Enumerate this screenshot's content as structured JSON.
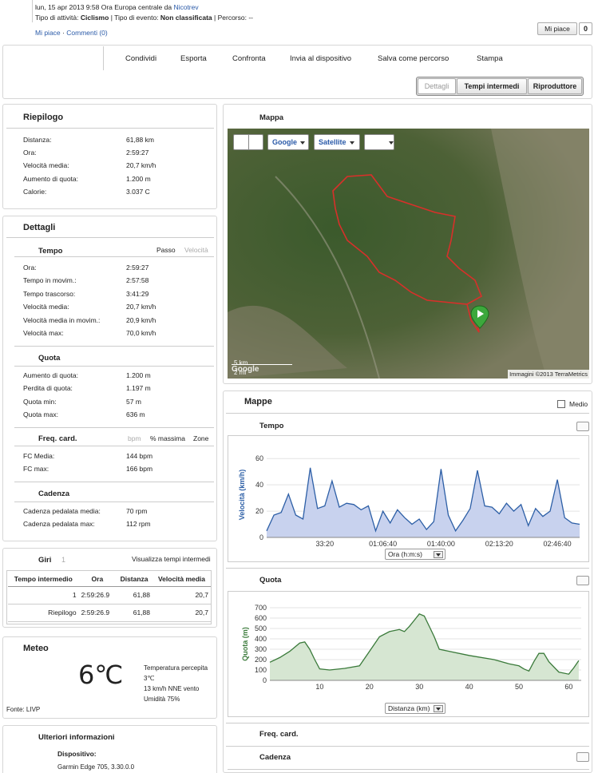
{
  "activity": {
    "date_line": "lun, 15 apr 2013 9:58 Ora Europa centrale da",
    "user": "Nicotrev",
    "type_label": "Tipo di attività:",
    "type_value": "Ciclismo",
    "event_label": "| Tipo di evento:",
    "event_value": "Non classificata",
    "route_label": "| Percorso: --",
    "like_link": "Mi piace",
    "comments_link": "Commenti (0)",
    "like_button": "Mi piace",
    "like_count": "0"
  },
  "toolbar": {
    "share": "Condividi",
    "export": "Esporta",
    "compare": "Confronta",
    "send": "Invia al dispositivo",
    "save_route": "Salva come percorso",
    "print": "Stampa"
  },
  "view_tabs": [
    "Dettagli",
    "Tempi intermedi",
    "Riproduttore"
  ],
  "summary": {
    "title": "Riepilogo",
    "rows": [
      {
        "label": "Distanza:",
        "value": "61,88 km"
      },
      {
        "label": "Ora:",
        "value": "2:59:27"
      },
      {
        "label": "Velocità media:",
        "value": "20,7 km/h"
      },
      {
        "label": "Aumento di quota:",
        "value": "1.200 m"
      },
      {
        "label": "Calorie:",
        "value": "3.037 C"
      }
    ]
  },
  "details": {
    "title": "Dettagli",
    "time_title": "Tempo",
    "pace_toggle": "Passo",
    "speed_toggle": "Velocità",
    "time_rows": [
      {
        "label": "Ora:",
        "value": "2:59:27"
      },
      {
        "label": "Tempo in movim.:",
        "value": "2:57:58"
      },
      {
        "label": "Tempo trascorso:",
        "value": "3:41:29"
      },
      {
        "label": "Velocità media:",
        "value": "20,7 km/h"
      },
      {
        "label": "Velocità media in movim.:",
        "value": "20,9 km/h"
      },
      {
        "label": "Velocità max:",
        "value": "70,0 km/h"
      }
    ],
    "elev_title": "Quota",
    "elev_rows": [
      {
        "label": "Aumento di quota:",
        "value": "1.200 m"
      },
      {
        "label": "Perdita di quota:",
        "value": "1.197 m"
      },
      {
        "label": "Quota min:",
        "value": "57 m"
      },
      {
        "label": "Quota max:",
        "value": "636 m"
      }
    ],
    "hr_title": "Freq. card.",
    "hr_bpm": "bpm",
    "hr_pct": "% massima",
    "hr_zones": "Zone",
    "hr_rows": [
      {
        "label": "FC Media:",
        "value": "144 bpm"
      },
      {
        "label": "FC max:",
        "value": "166 bpm"
      }
    ],
    "cad_title": "Cadenza",
    "cad_rows": [
      {
        "label": "Cadenza pedalata media:",
        "value": "70 rpm"
      },
      {
        "label": "Cadenza pedalata max:",
        "value": "112 rpm"
      }
    ]
  },
  "laps": {
    "title": "Giri",
    "count": "1",
    "view_link": "Visualizza tempi intermedi",
    "headers": [
      "Tempo intermedio",
      "Ora",
      "Distanza",
      "Velocità media"
    ],
    "rows": [
      [
        "1",
        "2:59:26.9",
        "61,88",
        "20,7"
      ],
      [
        "Riepilogo",
        "2:59:26.9",
        "61,88",
        "20,7"
      ]
    ]
  },
  "weather": {
    "title": "Meteo",
    "temp": "6℃",
    "feels_label": "Temperatura percepita",
    "feels_value": "3℃",
    "wind": "13 km/h NNE vento",
    "humidity": "Umidità 75%",
    "source": "Fonte: LIVP"
  },
  "more_info": {
    "title": "Ulteriori informazioni",
    "device_label": "Dispositivo:",
    "device_value": "Garmin Edge 705, 3.30.0.0"
  },
  "map": {
    "title": "Mappa",
    "type_google": "Google",
    "type_satellite": "Satellite",
    "scale_km": "5 km",
    "scale_mi": "2 mi",
    "attribution": "Immagini ©2013 TerraMetrics",
    "google_logo": "Google",
    "colors": {
      "satellite": "#4a5a33",
      "track": "#d7302a",
      "pin": "#3ca83c"
    }
  },
  "charts_panel": {
    "title": "Mappe",
    "medio_label": "Medio",
    "speed_title": "Tempo",
    "elev_title": "Quota",
    "hr_title": "Freq. card.",
    "cad_title": "Cadenza",
    "speed_axis_select": "Ora (h:m:s)",
    "elev_axis_select": "Distanza (km)"
  },
  "chart_data": [
    {
      "type": "area",
      "ylabel": "Velocità (km/h)",
      "xlabel": "Ora (h:m:s)",
      "ylim": [
        0,
        65
      ],
      "yticks": [
        0,
        20,
        40,
        60
      ],
      "xlim": [
        0,
        10767
      ],
      "xticks": [
        2000,
        4000,
        6000,
        8000,
        10000
      ],
      "xtick_labels": [
        "33:20",
        "01:06:40",
        "01:40:00",
        "02:13:20",
        "02:46:40"
      ],
      "line_color": "#2d5fa6",
      "fill_color": "#c8d2ee",
      "x": [
        0,
        250,
        500,
        750,
        1000,
        1250,
        1500,
        1750,
        2000,
        2250,
        2500,
        2750,
        3000,
        3250,
        3500,
        3750,
        4000,
        4250,
        4500,
        4750,
        5000,
        5250,
        5500,
        5750,
        6000,
        6250,
        6500,
        6750,
        7000,
        7250,
        7500,
        7750,
        8000,
        8250,
        8500,
        8750,
        9000,
        9250,
        9500,
        9750,
        10000,
        10250,
        10500,
        10767
      ],
      "values": [
        5,
        17,
        19,
        33,
        17,
        14,
        53,
        22,
        24,
        43,
        23,
        26,
        25,
        21,
        24,
        5,
        20,
        11,
        21,
        15,
        10,
        14,
        6,
        12,
        52,
        17,
        5,
        13,
        22,
        51,
        24,
        23,
        18,
        26,
        20,
        25,
        9,
        22,
        16,
        20,
        44,
        15,
        11,
        10
      ]
    },
    {
      "type": "area",
      "ylabel": "Quota (m)",
      "xlabel": "Distanza (km)",
      "ylim": [
        0,
        700
      ],
      "yticks": [
        0,
        100,
        200,
        300,
        400,
        500,
        600,
        700
      ],
      "xlim": [
        0,
        62.5
      ],
      "xticks": [
        10,
        20,
        30,
        40,
        50,
        60
      ],
      "line_color": "#3a7a3a",
      "fill_color": "#d6e6d2",
      "x": [
        0,
        2,
        4,
        6,
        7,
        8,
        9,
        10,
        12,
        15,
        18,
        20,
        22,
        24,
        26,
        27,
        28,
        29,
        30,
        31,
        32,
        33,
        34,
        36,
        40,
        45,
        48,
        50,
        51,
        52,
        53,
        54,
        55,
        56,
        58,
        60,
        61,
        62
      ],
      "values": [
        175,
        220,
        280,
        360,
        370,
        300,
        200,
        110,
        100,
        115,
        140,
        280,
        420,
        470,
        490,
        470,
        520,
        580,
        640,
        620,
        520,
        420,
        300,
        280,
        240,
        200,
        160,
        140,
        110,
        90,
        180,
        260,
        260,
        180,
        80,
        60,
        120,
        190
      ]
    }
  ]
}
